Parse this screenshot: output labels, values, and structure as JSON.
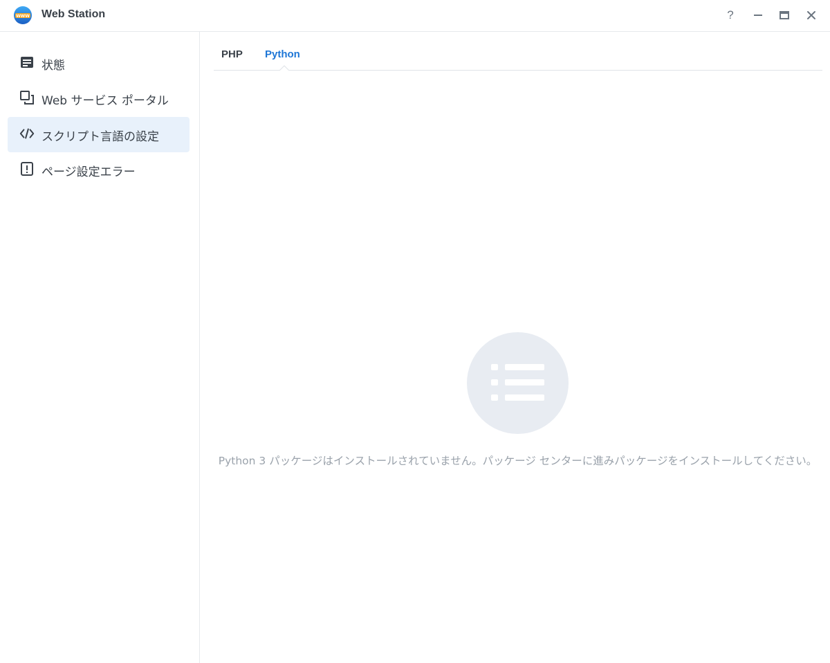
{
  "window": {
    "title": "Web Station",
    "logo_text": "WWW",
    "help_label": "?"
  },
  "sidebar": {
    "items": [
      {
        "label": "状態",
        "icon": "status-icon",
        "active": false
      },
      {
        "label": "Web サービス ポータル",
        "icon": "portal-icon",
        "active": false
      },
      {
        "label": "スクリプト言語の設定",
        "icon": "code-icon",
        "active": true
      },
      {
        "label": "ページ設定エラー",
        "icon": "error-icon",
        "active": false
      }
    ]
  },
  "tabs": [
    {
      "label": "PHP",
      "active": false
    },
    {
      "label": "Python",
      "active": true
    }
  ],
  "empty_state": {
    "icon": "list-icon",
    "message": "Python 3 パッケージはインストールされていません。パッケージ センターに進みパッケージをインストールしてください。"
  },
  "colors": {
    "accent": "#1e76d6",
    "active_bg": "#e8f1fb",
    "muted_text": "#9aa2ab",
    "empty_circle": "#e8ecf2"
  }
}
